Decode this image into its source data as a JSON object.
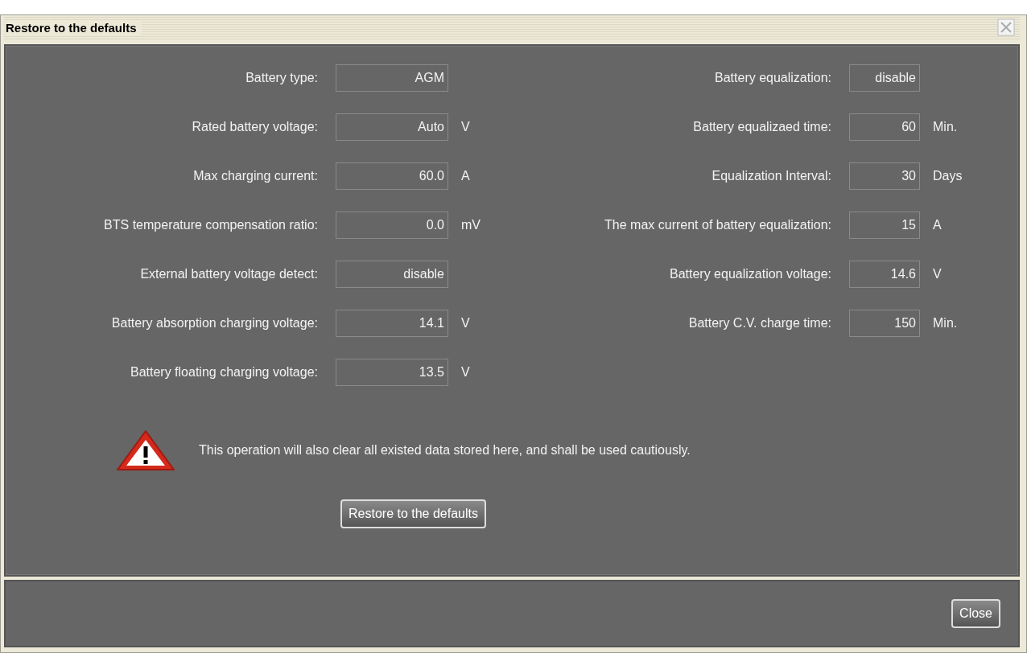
{
  "window": {
    "title": "Restore to the defaults"
  },
  "left_settings": [
    {
      "label": "Battery type:",
      "value": "AGM"
    },
    {
      "label": "Rated battery voltage:",
      "value": "Auto",
      "unit": "V"
    },
    {
      "label": "Max charging current:",
      "value": "60.0",
      "unit": "A"
    },
    {
      "label": "BTS temperature compensation ratio:",
      "value": "0.0",
      "unit": "mV"
    },
    {
      "label": "External battery voltage detect:",
      "value": "disable"
    },
    {
      "label": "Battery absorption charging voltage:",
      "value": "14.1",
      "unit": "V"
    },
    {
      "label": "Battery floating charging voltage:",
      "value": "13.5",
      "unit": "V"
    }
  ],
  "right_settings": [
    {
      "label": "Battery equalization:",
      "value": "disable"
    },
    {
      "label": "Battery equalizaed time:",
      "value": "60",
      "unit": "Min."
    },
    {
      "label": "Equalization Interval:",
      "value": "30",
      "unit": "Days"
    },
    {
      "label": "The max current of battery equalization:",
      "value": "15",
      "unit": "A"
    },
    {
      "label": "Battery equalization voltage:",
      "value": "14.6",
      "unit": "V"
    },
    {
      "label": "Battery C.V. charge time:",
      "value": "150",
      "unit": "Min."
    }
  ],
  "warning": {
    "text": "This operation will also clear all existed data stored here, and shall be used cautiously."
  },
  "restore_button": "Restore to the defaults",
  "close_button": "Close"
}
